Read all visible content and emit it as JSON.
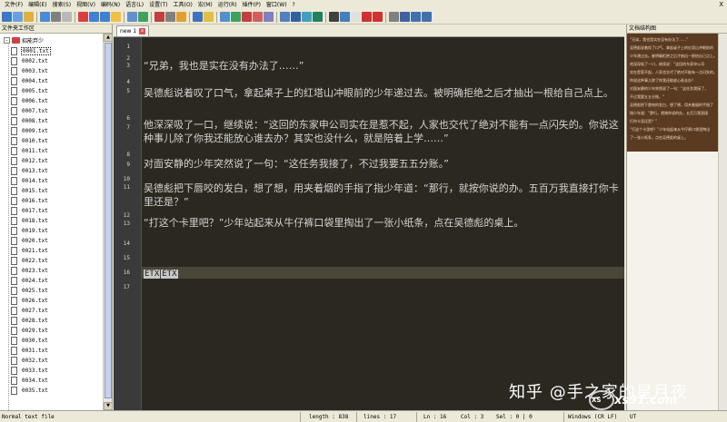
{
  "menu": [
    "文件(F)",
    "编辑(E)",
    "搜索(S)",
    "视图(V)",
    "编码(N)",
    "语言(L)",
    "设置(T)",
    "工具(O)",
    "宏(M)",
    "运行(R)",
    "插件(P)",
    "窗口(W)",
    "?"
  ],
  "menu_close": "X",
  "toolbar_colors": [
    "#3a78c8",
    "#6aa0e0",
    "#e0b040",
    "#4a8ad8",
    "#808080",
    "#b8b8b8",
    "#d84040",
    "#4080d0",
    "#4080d0",
    "#f0c040",
    "#6090d0",
    "#40a060",
    "#c04040",
    "#808080",
    "#e0a030",
    "#4070c0",
    "#e0c040",
    "#5090d0",
    "#40a060",
    "#c04040",
    "#d06060",
    "#8080c0",
    "#5080c0",
    "#3060a0",
    "#40a0c0",
    "#208060",
    "#404040",
    "#4080c0",
    "#e0e0e0",
    "#d03030",
    "#d03030",
    "#808080",
    "#4060a0",
    "#4070b0",
    "#4070b0"
  ],
  "left_panel": {
    "title": "文件夹工作区",
    "root_label": "招能弃少",
    "expander": "-",
    "files": [
      "0001.txt",
      "0002.txt",
      "0003.txt",
      "0004.txt",
      "0005.txt",
      "0006.txt",
      "0007.txt",
      "0008.txt",
      "0009.txt",
      "0010.txt",
      "0011.txt",
      "0012.txt",
      "0013.txt",
      "0014.txt",
      "0015.txt",
      "0016.txt",
      "0017.txt",
      "0018.txt",
      "0019.txt",
      "0020.txt",
      "0021.txt",
      "0022.txt",
      "0023.txt",
      "0024.txt",
      "0025.txt",
      "0026.txt",
      "0027.txt",
      "0028.txt",
      "0029.txt",
      "0030.txt",
      "0031.txt",
      "0032.txt",
      "0033.txt",
      "0034.txt",
      "0035.txt"
    ]
  },
  "editor": {
    "tab_label": "new 1",
    "tab_close": "x",
    "line_numbers": [
      "1",
      "2",
      "3",
      "4",
      "5",
      "6",
      "7",
      "8",
      "9",
      "10",
      "11",
      "12",
      "13",
      "14",
      "15",
      "16",
      "17"
    ],
    "lines": [
      "",
      "",
      "“兄弟，我也是实在没有办法了……”",
      "",
      "吴德彪说着叹了口气，拿起桌子上的红塔山冲眼前的少年递过去。被明确拒绝之后才抽出一根给自己点上。",
      "",
      "他深深吸了一口，继续说：“这回的东家申公司实在是惹不起，人家也交代了绝对不能有一点闪失的。你说这种事儿除了你我还能放心谁去办？其实也没什么，就是陪着上学……”",
      "",
      "对面安静的少年突然说了一句：“这任务我接了，不过我要五五分账。”",
      "",
      "吴德彪把下唇咬的发白，想了想，用夹着烟的手指了指少年道：“那行，就按你说的办。五百万我直接打你卡里还是？”",
      "",
      "“打这个卡里吧？”少年站起来从牛仔裤口袋里掏出了一张小纸条，点在吴德彪的桌上。",
      "",
      "",
      "",
      ""
    ],
    "etx_tokens": [
      "ETX",
      "ETX"
    ]
  },
  "right_panel": {
    "title": "文档结构图",
    "preview_lines": [
      "“兄弟，我也是实在没有办法了……”",
      "吴德彪说着叹了口气，拿起桌子上的红塔山冲眼前的",
      "少年递过去。被明确拒绝之后才抽出一根给自己点上。",
      "他深深吸了一口，继续说：“这回的东家申公司",
      "实在是惹不起，人家也交代了绝对不能有一点闪失的。",
      "你说这种事儿除了你我还能放心谁去办？",
      "对面安静的少年突然说了一句：“这任务我接了，",
      "不过我要五五分账。”",
      "吴德彪把下唇咬的发白，想了想，用夹着烟的手指了",
      "指少年道：“那行，就按你说的办。五百万我直接",
      "打你卡里还是？”",
      "“打这个卡里吧？”少年站起来从牛仔裤口袋里掏出",
      "了一张小纸条，点在吴德彪的桌上。"
    ]
  },
  "status": {
    "file_type": "Normal text file",
    "length": "length : 838",
    "lines": "lines : 17",
    "ln": "Ln : 16",
    "col": "Col : 3",
    "sel": "Sel : 0 | 0",
    "eol": "Windows (CR LF)",
    "enc": "UT"
  },
  "watermark": {
    "text": "知乎 @手之家的星月夜",
    "logo": "XS",
    "site": "xs91.com"
  }
}
